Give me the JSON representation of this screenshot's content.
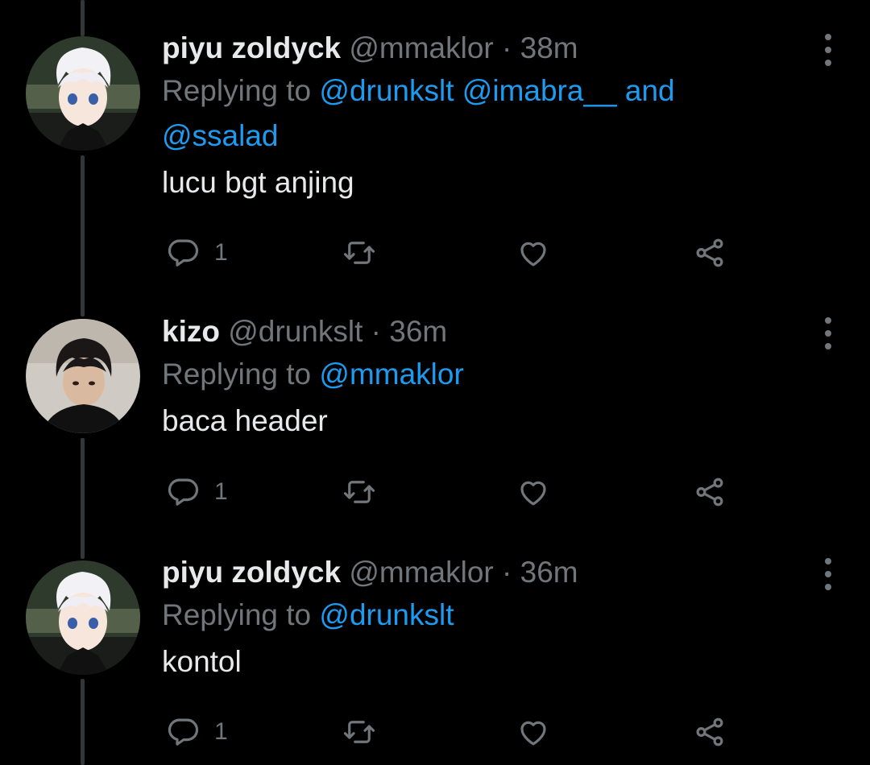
{
  "tweets": [
    {
      "display_name": "piyu zoldyck",
      "handle": "@mmaklor",
      "separator": "·",
      "time": "38m",
      "replying_prefix": "Replying to",
      "mentions_line1": [
        "@drunkslt",
        "@imabra__"
      ],
      "and_word": "and",
      "mentions_line2": [
        "@ssalad"
      ],
      "text": "lucu bgt anjing",
      "reply_count": "1",
      "avatar": "anime-white-hair-boy-avatar"
    },
    {
      "display_name": "kizo",
      "handle": "@drunkslt",
      "separator": "·",
      "time": "36m",
      "replying_prefix": "Replying to",
      "mentions_line1": [
        "@mmaklor"
      ],
      "text": "baca header",
      "reply_count": "1",
      "avatar": "dark-hair-person-avatar"
    },
    {
      "display_name": "piyu zoldyck",
      "handle": "@mmaklor",
      "separator": "·",
      "time": "36m",
      "replying_prefix": "Replying to",
      "mentions_line1": [
        "@drunkslt"
      ],
      "text": "kontol",
      "reply_count": "1",
      "avatar": "anime-white-hair-boy-avatar"
    }
  ],
  "icons": {
    "reply": "speech-bubble-icon",
    "retweet": "retweet-icon",
    "like": "heart-icon",
    "share": "share-icon",
    "more": "more-vertical-icon"
  },
  "colors": {
    "background": "#000000",
    "text": "#e7e9ea",
    "secondary": "#71767b",
    "accent": "#1d9bf0",
    "thread_line": "#333639"
  }
}
